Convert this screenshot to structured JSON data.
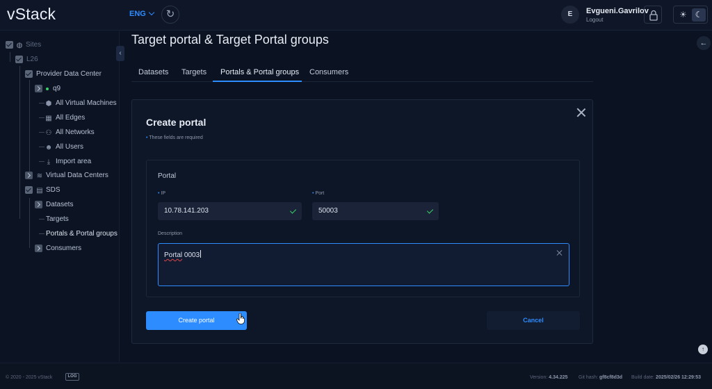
{
  "header": {
    "logo": "vStack",
    "language": "ENG",
    "user_initial": "E",
    "username": "Evgueni.Gavrilov",
    "logout": "Logout"
  },
  "sidebar": {
    "items": [
      {
        "label": "Sites",
        "icon": "globe-icon"
      },
      {
        "label": "L26",
        "icon": ""
      },
      {
        "label": "Provider Data Center",
        "icon": ""
      },
      {
        "label": "q9",
        "icon": "status-dot"
      },
      {
        "label": "All Virtual Machines",
        "icon": "cube-icon"
      },
      {
        "label": "All Edges",
        "icon": "edge-icon"
      },
      {
        "label": "All Networks",
        "icon": "network-icon"
      },
      {
        "label": "All Users",
        "icon": "users-icon"
      },
      {
        "label": "Import area",
        "icon": "download-icon"
      },
      {
        "label": "Virtual Data Centers",
        "icon": "stack-icon"
      },
      {
        "label": "SDS",
        "icon": "storage-icon"
      },
      {
        "label": "Datasets",
        "icon": ""
      },
      {
        "label": "Targets",
        "icon": ""
      },
      {
        "label": "Portals & Portal groups",
        "icon": ""
      },
      {
        "label": "Consumers",
        "icon": ""
      }
    ]
  },
  "main": {
    "title": "Target portal & Target Portal groups",
    "tabs": [
      {
        "label": "Datasets"
      },
      {
        "label": "Targets"
      },
      {
        "label": "Portals & Portal groups",
        "active": true
      },
      {
        "label": "Consumers"
      }
    ]
  },
  "modal": {
    "title": "Create portal",
    "required_note": "These fields are required",
    "section_title": "Portal",
    "ip_label": "IP",
    "ip_value": "10.78.141.203",
    "port_label": "Port",
    "port_value": "50003",
    "description_label": "Description",
    "description_word": "Portal",
    "description_rest": " 0003",
    "create_button": "Create portal",
    "cancel_button": "Cancel"
  },
  "footer": {
    "copyright": "© 2020 - 2025 vStack",
    "log_badge": "LOG",
    "version_label": "Version:",
    "version_value": "4.34.225",
    "git_label": "Git hash:",
    "git_value": "gf8cf8d3d",
    "build_label": "Build date:",
    "build_value": "2025/02/26 12:29:53"
  },
  "colors": {
    "accent": "#2d8cff",
    "background": "#0b1322",
    "success": "#38d36a"
  }
}
